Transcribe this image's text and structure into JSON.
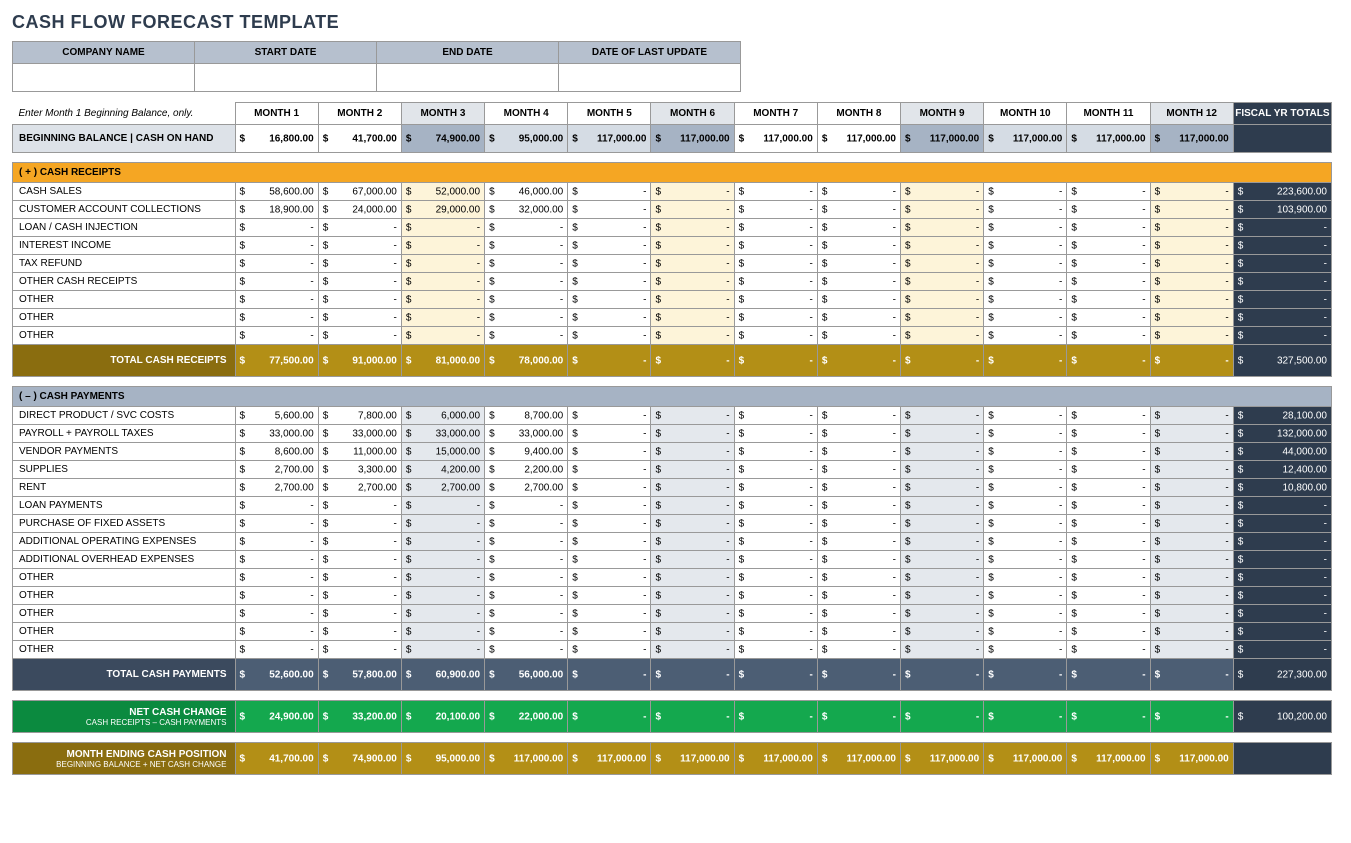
{
  "title": "CASH FLOW FORECAST TEMPLATE",
  "info_headers": [
    "COMPANY NAME",
    "START DATE",
    "END DATE",
    "DATE OF LAST UPDATE"
  ],
  "instruction": "Enter Month 1 Beginning Balance, only.",
  "month_labels": [
    "MONTH 1",
    "MONTH 2",
    "MONTH 3",
    "MONTH 4",
    "MONTH 5",
    "MONTH 6",
    "MONTH 7",
    "MONTH 8",
    "MONTH 9",
    "MONTH 10",
    "MONTH 11",
    "MONTH 12"
  ],
  "month_shaded": [
    false,
    false,
    true,
    false,
    false,
    true,
    false,
    false,
    true,
    false,
    false,
    true
  ],
  "fiscal_label": "FISCAL YR TOTALS",
  "beginning_balance": {
    "label": "BEGINNING BALANCE  |  CASH ON HAND",
    "values": [
      "16,800.00",
      "41,700.00",
      "74,900.00",
      "95,000.00",
      "117,000.00",
      "117,000.00",
      "117,000.00",
      "117,000.00",
      "117,000.00",
      "117,000.00",
      "117,000.00",
      "117,000.00"
    ],
    "shade_pattern": [
      "plain",
      "plain",
      "bbsh",
      "bblt",
      "bblt",
      "bbsh",
      "plain",
      "plain",
      "bbsh",
      "bblt",
      "bblt",
      "bbsh"
    ]
  },
  "receipts": {
    "header": "( + )   CASH RECEIPTS",
    "rows": [
      {
        "label": "CASH SALES",
        "values": [
          "58,600.00",
          "67,000.00",
          "52,000.00",
          "46,000.00",
          "-",
          "-",
          "-",
          "-",
          "-",
          "-",
          "-",
          "-"
        ],
        "fy": "223,600.00"
      },
      {
        "label": "CUSTOMER ACCOUNT COLLECTIONS",
        "values": [
          "18,900.00",
          "24,000.00",
          "29,000.00",
          "32,000.00",
          "-",
          "-",
          "-",
          "-",
          "-",
          "-",
          "-",
          "-"
        ],
        "fy": "103,900.00"
      },
      {
        "label": "LOAN / CASH INJECTION",
        "values": [
          "-",
          "-",
          "-",
          "-",
          "-",
          "-",
          "-",
          "-",
          "-",
          "-",
          "-",
          "-"
        ],
        "fy": "-"
      },
      {
        "label": "INTEREST INCOME",
        "values": [
          "-",
          "-",
          "-",
          "-",
          "-",
          "-",
          "-",
          "-",
          "-",
          "-",
          "-",
          "-"
        ],
        "fy": "-"
      },
      {
        "label": "TAX REFUND",
        "values": [
          "-",
          "-",
          "-",
          "-",
          "-",
          "-",
          "-",
          "-",
          "-",
          "-",
          "-",
          "-"
        ],
        "fy": "-"
      },
      {
        "label": "OTHER CASH RECEIPTS",
        "values": [
          "-",
          "-",
          "-",
          "-",
          "-",
          "-",
          "-",
          "-",
          "-",
          "-",
          "-",
          "-"
        ],
        "fy": "-"
      },
      {
        "label": "OTHER",
        "values": [
          "-",
          "-",
          "-",
          "-",
          "-",
          "-",
          "-",
          "-",
          "-",
          "-",
          "-",
          "-"
        ],
        "fy": "-"
      },
      {
        "label": "OTHER",
        "values": [
          "-",
          "-",
          "-",
          "-",
          "-",
          "-",
          "-",
          "-",
          "-",
          "-",
          "-",
          "-"
        ],
        "fy": "-"
      },
      {
        "label": "OTHER",
        "values": [
          "-",
          "-",
          "-",
          "-",
          "-",
          "-",
          "-",
          "-",
          "-",
          "-",
          "-",
          "-"
        ],
        "fy": "-"
      }
    ],
    "total_label": "TOTAL CASH RECEIPTS",
    "total_values": [
      "77,500.00",
      "91,000.00",
      "81,000.00",
      "78,000.00",
      "-",
      "-",
      "-",
      "-",
      "-",
      "-",
      "-",
      "-"
    ],
    "total_fy": "327,500.00"
  },
  "payments": {
    "header": "( – )   CASH PAYMENTS",
    "rows": [
      {
        "label": "DIRECT PRODUCT / SVC COSTS",
        "values": [
          "5,600.00",
          "7,800.00",
          "6,000.00",
          "8,700.00",
          "-",
          "-",
          "-",
          "-",
          "-",
          "-",
          "-",
          "-"
        ],
        "fy": "28,100.00"
      },
      {
        "label": "PAYROLL + PAYROLL TAXES",
        "values": [
          "33,000.00",
          "33,000.00",
          "33,000.00",
          "33,000.00",
          "-",
          "-",
          "-",
          "-",
          "-",
          "-",
          "-",
          "-"
        ],
        "fy": "132,000.00"
      },
      {
        "label": "VENDOR PAYMENTS",
        "values": [
          "8,600.00",
          "11,000.00",
          "15,000.00",
          "9,400.00",
          "-",
          "-",
          "-",
          "-",
          "-",
          "-",
          "-",
          "-"
        ],
        "fy": "44,000.00"
      },
      {
        "label": "SUPPLIES",
        "values": [
          "2,700.00",
          "3,300.00",
          "4,200.00",
          "2,200.00",
          "-",
          "-",
          "-",
          "-",
          "-",
          "-",
          "-",
          "-"
        ],
        "fy": "12,400.00"
      },
      {
        "label": "RENT",
        "values": [
          "2,700.00",
          "2,700.00",
          "2,700.00",
          "2,700.00",
          "-",
          "-",
          "-",
          "-",
          "-",
          "-",
          "-",
          "-"
        ],
        "fy": "10,800.00"
      },
      {
        "label": "LOAN PAYMENTS",
        "values": [
          "-",
          "-",
          "-",
          "-",
          "-",
          "-",
          "-",
          "-",
          "-",
          "-",
          "-",
          "-"
        ],
        "fy": "-"
      },
      {
        "label": "PURCHASE OF FIXED ASSETS",
        "values": [
          "-",
          "-",
          "-",
          "-",
          "-",
          "-",
          "-",
          "-",
          "-",
          "-",
          "-",
          "-"
        ],
        "fy": "-"
      },
      {
        "label": "ADDITIONAL OPERATING EXPENSES",
        "values": [
          "-",
          "-",
          "-",
          "-",
          "-",
          "-",
          "-",
          "-",
          "-",
          "-",
          "-",
          "-"
        ],
        "fy": "-"
      },
      {
        "label": "ADDITIONAL OVERHEAD EXPENSES",
        "values": [
          "-",
          "-",
          "-",
          "-",
          "-",
          "-",
          "-",
          "-",
          "-",
          "-",
          "-",
          "-"
        ],
        "fy": "-"
      },
      {
        "label": "OTHER",
        "values": [
          "-",
          "-",
          "-",
          "-",
          "-",
          "-",
          "-",
          "-",
          "-",
          "-",
          "-",
          "-"
        ],
        "fy": "-"
      },
      {
        "label": "OTHER",
        "values": [
          "-",
          "-",
          "-",
          "-",
          "-",
          "-",
          "-",
          "-",
          "-",
          "-",
          "-",
          "-"
        ],
        "fy": "-"
      },
      {
        "label": "OTHER",
        "values": [
          "-",
          "-",
          "-",
          "-",
          "-",
          "-",
          "-",
          "-",
          "-",
          "-",
          "-",
          "-"
        ],
        "fy": "-"
      },
      {
        "label": "OTHER",
        "values": [
          "-",
          "-",
          "-",
          "-",
          "-",
          "-",
          "-",
          "-",
          "-",
          "-",
          "-",
          "-"
        ],
        "fy": "-"
      },
      {
        "label": "OTHER",
        "values": [
          "-",
          "-",
          "-",
          "-",
          "-",
          "-",
          "-",
          "-",
          "-",
          "-",
          "-",
          "-"
        ],
        "fy": "-"
      }
    ],
    "total_label": "TOTAL CASH PAYMENTS",
    "total_values": [
      "52,600.00",
      "57,800.00",
      "60,900.00",
      "56,000.00",
      "-",
      "-",
      "-",
      "-",
      "-",
      "-",
      "-",
      "-"
    ],
    "total_fy": "227,300.00"
  },
  "net_change": {
    "label": "NET CASH CHANGE",
    "sub": "CASH RECEIPTS – CASH PAYMENTS",
    "values": [
      "24,900.00",
      "33,200.00",
      "20,100.00",
      "22,000.00",
      "-",
      "-",
      "-",
      "-",
      "-",
      "-",
      "-",
      "-"
    ],
    "fy": "100,200.00"
  },
  "ending_position": {
    "label": "MONTH ENDING CASH POSITION",
    "sub": "BEGINNING BALANCE + NET CASH CHANGE",
    "values": [
      "41,700.00",
      "74,900.00",
      "95,000.00",
      "117,000.00",
      "117,000.00",
      "117,000.00",
      "117,000.00",
      "117,000.00",
      "117,000.00",
      "117,000.00",
      "117,000.00",
      "117,000.00"
    ],
    "fy": ""
  }
}
